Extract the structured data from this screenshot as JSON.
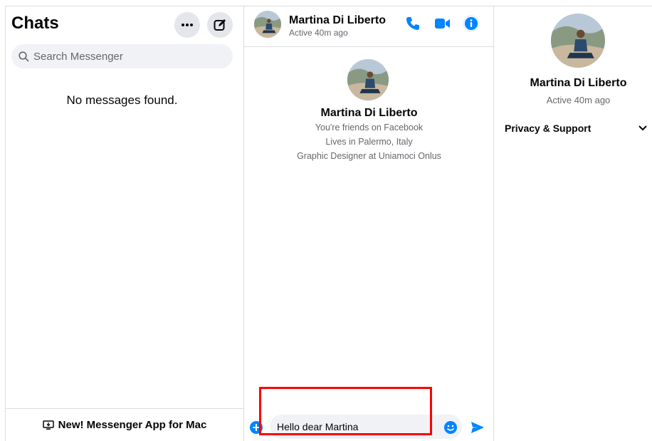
{
  "left_pane": {
    "title": "Chats",
    "more_icon": "ellipsis-icon",
    "compose_icon": "compose-icon",
    "search": {
      "placeholder": "Search Messenger",
      "value": "",
      "icon": "search-icon"
    },
    "empty_state": "No messages found.",
    "banner": {
      "label": "New! Messenger App for Mac",
      "icon": "desktop-icon"
    }
  },
  "conversation": {
    "contact_name": "Martina Di Liberto",
    "status": "Active 40m ago",
    "actions": [
      {
        "name": "call",
        "icon": "phone-icon"
      },
      {
        "name": "video",
        "icon": "video-icon"
      },
      {
        "name": "info",
        "icon": "info-icon"
      }
    ],
    "intro": {
      "name": "Martina Di Liberto",
      "lines": [
        "You're friends on Facebook",
        "Lives in Palermo, Italy",
        "Graphic Designer at Uniamoci Onlus"
      ]
    },
    "composer": {
      "value": "Hello dear Martina",
      "placeholder": "Aa"
    }
  },
  "details_pane": {
    "name": "Martina Di Liberto",
    "status": "Active 40m ago",
    "sections": [
      {
        "label": "Privacy & Support",
        "icon": "chevron-down-icon"
      }
    ]
  },
  "colors": {
    "accent": "#0084ff",
    "highlight": "#ff0000",
    "muted_text": "#65676b",
    "bubble_bg": "#f0f2f5"
  }
}
